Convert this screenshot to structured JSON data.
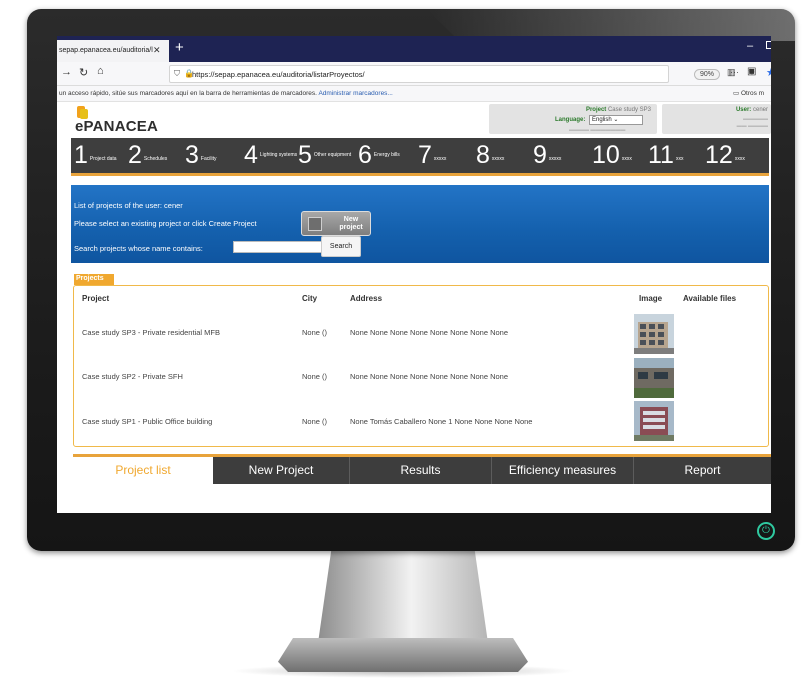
{
  "browser": {
    "tab_title": "sepap.epanacea.eu/auditoria/l",
    "tab_close": "✕",
    "new_tab": "+",
    "url_host": "https://sepap.epanacea.eu/auditoria/listarProyectos/",
    "zoom": "90%",
    "bookmarks_hint": "un acceso rápido, sitúe sus marcadores aquí en la barra de herramientas de marcadores.",
    "manage_bookmarks": "Administrar marcadores...",
    "other_bookmarks": "Otros m"
  },
  "app": {
    "logo": "ePANACEA",
    "project_label": "Project",
    "project_value": "Case study SP3",
    "language_label": "Language:",
    "language_value": "English",
    "user_label": "User:",
    "user_value": "cener",
    "steps": [
      {
        "num": "1",
        "label": "Project data"
      },
      {
        "num": "2",
        "label": "Schedules"
      },
      {
        "num": "3",
        "label": "Facility"
      },
      {
        "num": "4",
        "label": "Lighting systems"
      },
      {
        "num": "5",
        "label": "Other equipment"
      },
      {
        "num": "6",
        "label": "Energy bills"
      },
      {
        "num": "7",
        "label": "xxxxx"
      },
      {
        "num": "8",
        "label": "xxxxx"
      },
      {
        "num": "9",
        "label": "xxxxx"
      },
      {
        "num": "10",
        "label": "xxxx"
      },
      {
        "num": "11",
        "label": "xxx"
      },
      {
        "num": "12",
        "label": "xxxx"
      }
    ],
    "panel": {
      "line1": "List of projects of the user: cener",
      "line2": "Please select an existing project or click Create Project",
      "new_project_btn": "New project",
      "search_label": "Search projects whose name contains:",
      "search_value": "",
      "search_btn": "Search"
    },
    "projects_tab": "Projects",
    "table": {
      "headers": [
        "Project",
        "City",
        "Address",
        "Image",
        "Available files"
      ],
      "rows": [
        {
          "project": "Case study SP3 - Private residential MFB",
          "city": "None ()",
          "address": "None None None None None None None None"
        },
        {
          "project": "Case study SP2 - Private SFH",
          "city": "None ()",
          "address": "None None None None None None None None"
        },
        {
          "project": "Case study SP1 - Public Office building",
          "city": "None ()",
          "address": "None Tomás Caballero None 1 None None None None"
        }
      ]
    },
    "bottom_nav": [
      "Project list",
      "New Project",
      "Results",
      "Efficiency measures",
      "Report"
    ]
  },
  "colors": {
    "accent_orange": "#f0a82f",
    "panel_blue": "#1460ad",
    "dark_bar": "#3e3e3e",
    "power_green": "#2fc9a0"
  }
}
